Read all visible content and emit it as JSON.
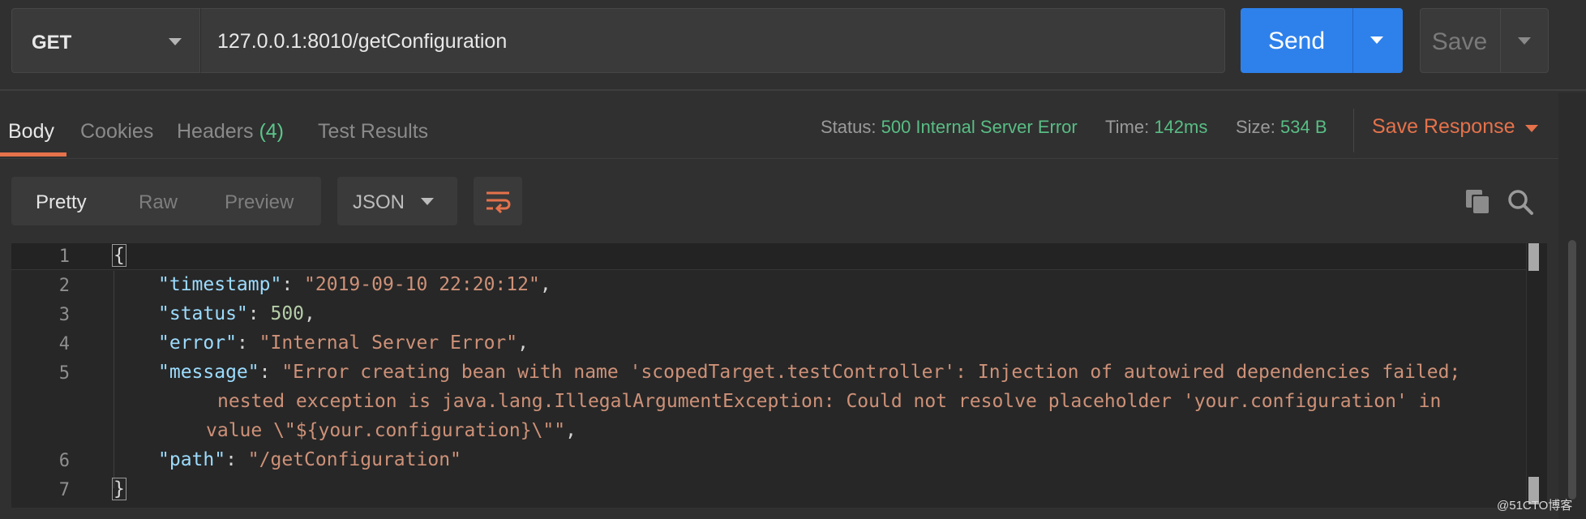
{
  "request": {
    "method": "GET",
    "url": "127.0.0.1:8010/getConfiguration",
    "send_label": "Send",
    "save_label": "Save"
  },
  "response_tabs": [
    {
      "label": "Body",
      "active": true
    },
    {
      "label": "Cookies"
    },
    {
      "label": "Headers",
      "count": "(4)"
    },
    {
      "label": "Test Results"
    }
  ],
  "response_meta": {
    "status_label": "Status:",
    "status_value": "500 Internal Server Error",
    "time_label": "Time:",
    "time_value": "142ms",
    "size_label": "Size:",
    "size_value": "534 B",
    "save_response_label": "Save Response"
  },
  "view": {
    "modes": [
      "Pretty",
      "Raw",
      "Preview"
    ],
    "active_mode": "Pretty",
    "format": "JSON"
  },
  "code": {
    "line_numbers": [
      "1",
      "2",
      "3",
      "4",
      "5",
      "6",
      "7"
    ],
    "open_brace": "{",
    "close_brace": "}",
    "fields": [
      {
        "key": "\"timestamp\"",
        "value": "\"2019-09-10 22:20:12\"",
        "trail": ","
      },
      {
        "key": "\"status\"",
        "value": "500",
        "trail": ","
      },
      {
        "key": "\"error\"",
        "value": "\"Internal Server Error\"",
        "trail": ","
      },
      {
        "key": "\"message\"",
        "value_lines": [
          "\"Error creating bean with name 'scopedTarget.testController': Injection of autowired dependencies failed;",
          "nested exception is java.lang.IllegalArgumentException: Could not resolve placeholder 'your.configuration' in",
          "value \\\"${your.configuration}\\\"\""
        ],
        "trail": ","
      },
      {
        "key": "\"path\"",
        "value": "\"/getConfiguration\"",
        "trail": ""
      }
    ]
  },
  "icons": {
    "method_dropdown": "chevron-down-icon",
    "send_dropdown": "chevron-down-icon",
    "save_dropdown": "chevron-down-icon",
    "wrap": "wrap-lines-icon",
    "copy": "copy-icon",
    "search": "search-icon"
  },
  "colors": {
    "send_button": "#2e81eb",
    "accent": "#e5724b",
    "status_ok_text": "#59bd85"
  },
  "watermark": "@51CTO博客"
}
